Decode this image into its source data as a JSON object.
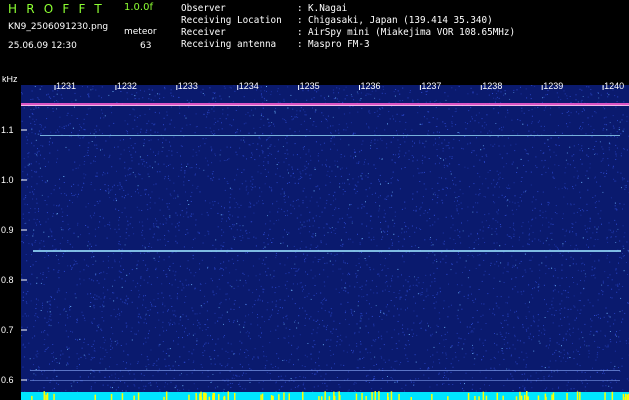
{
  "header": {
    "app_title": "HROFFT",
    "version": "1.0.0f",
    "filename": "KN9_2506091230.png",
    "meteor_label": "meteor",
    "timestamp": "25.06.09 12:30",
    "meteor_count": "63",
    "observer_label": "Observer",
    "observer_value": "K.Nagai",
    "location_label": "Receiving Location",
    "location_value": "Chigasaki, Japan (139.414 35.340)",
    "receiver_label": "Receiver",
    "receiver_value": "AirSpy mini (Miakejima VOR 108.65MHz)",
    "antenna_label": "Receiving antenna",
    "antenna_value": "Maspro FM-3",
    "separator": ":"
  },
  "spectrogram": {
    "y_unit": "kHz",
    "y_ticks": [
      "1.1",
      "1.0",
      "0.9",
      "0.8",
      "0.7",
      "0.6"
    ],
    "x_ticks": [
      "1231",
      "1232",
      "1233",
      "1234",
      "1235",
      "1236",
      "1237",
      "1238",
      "1239",
      "1240"
    ],
    "colors": {
      "background": "#0a1a6e",
      "noise_dim": "#2d4ad0",
      "noise_bright": "#6fb8ff",
      "carrier_top": "#ff5fd2",
      "carrier_line": "#9be3ff",
      "bottom_band": "#00e5ff",
      "bottom_spike": "#ffff00"
    }
  }
}
